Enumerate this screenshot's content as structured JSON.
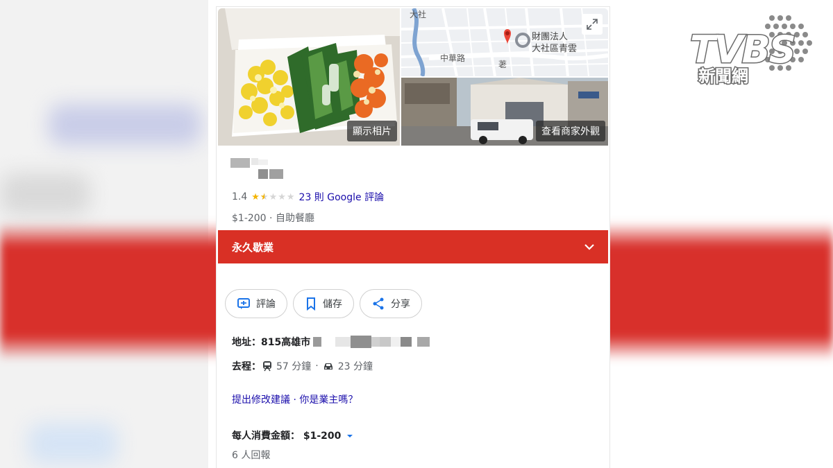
{
  "watermark": {
    "brand": "TVBS",
    "subtitle": "新聞網"
  },
  "photos": {
    "main_label": "顯示相片",
    "street_label": "查看商家外觀",
    "map_labels": [
      "中華路",
      "財團法人",
      "大社區青雲",
      "大社",
      "荖"
    ]
  },
  "place": {
    "rating": "1.4",
    "rating_value": 1.4,
    "reviews": "23 則 Google 評論",
    "price_category": "$1-200 · 自助餐廳"
  },
  "status": {
    "label": "永久歇業",
    "color": "#d93025"
  },
  "actions": [
    {
      "label": "評論",
      "icon": "review-icon"
    },
    {
      "label": "儲存",
      "icon": "bookmark-icon"
    },
    {
      "label": "分享",
      "icon": "share-icon"
    }
  ],
  "address": {
    "label": "地址：",
    "value": "815高雄市"
  },
  "travel": {
    "label": "去程：",
    "transit": "57 分鐘",
    "sep": "·",
    "drive": "23 分鐘"
  },
  "links": {
    "suggest": "提出修改建議 · 你是業主嗎？"
  },
  "spend": {
    "label": "每人消費金額：",
    "value": "$1-200",
    "reports": "6 人回報"
  }
}
